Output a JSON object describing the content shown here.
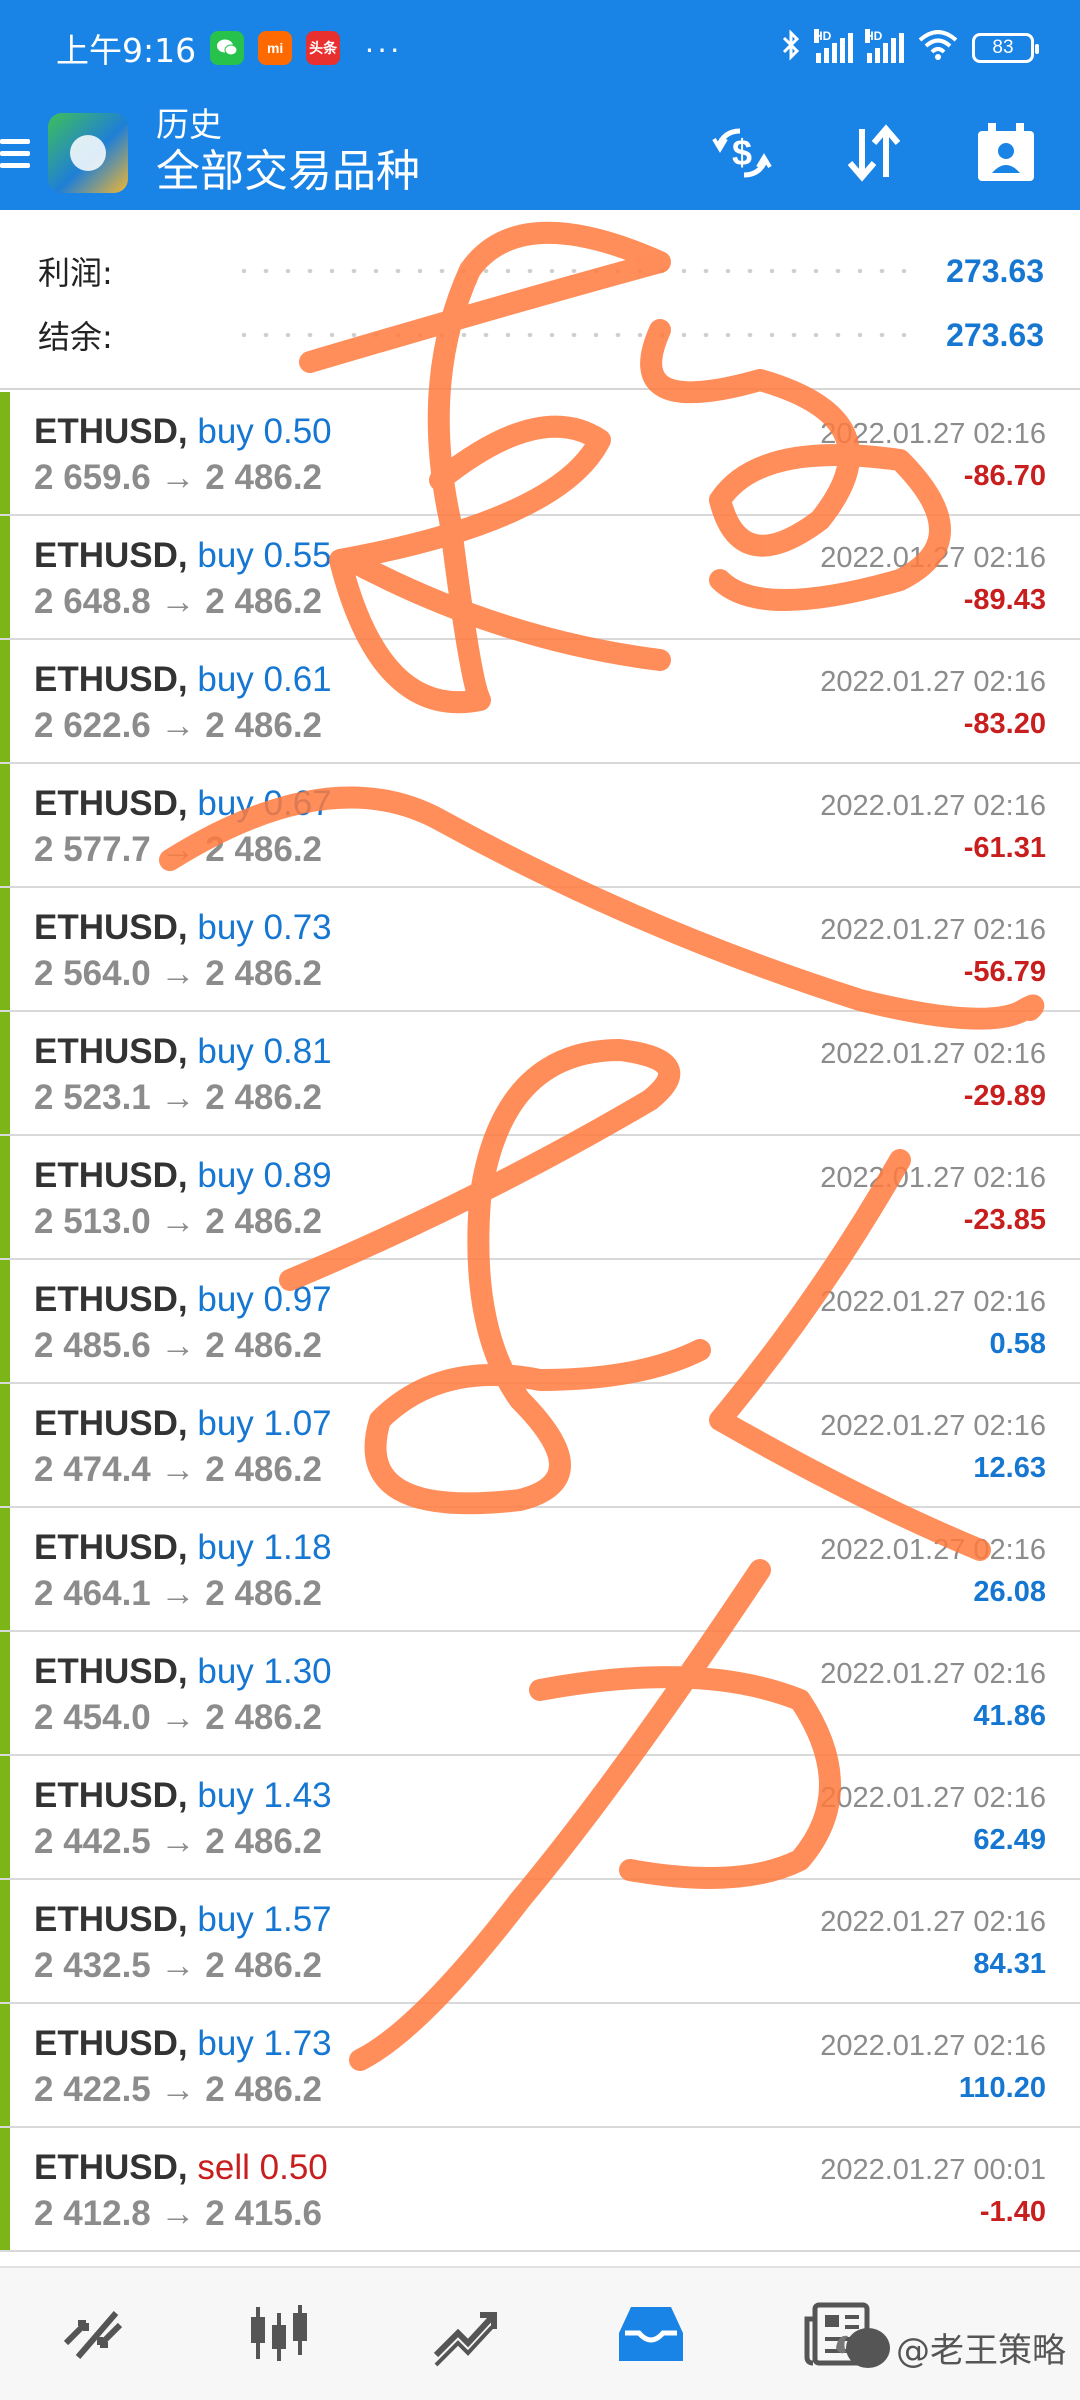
{
  "status_bar": {
    "time": "上午9:16",
    "apps": [
      {
        "label": "",
        "icon": "wechat-icon"
      },
      {
        "label": "mi",
        "icon": "mi-icon"
      },
      {
        "label": "头条",
        "icon": "toutiao-icon"
      }
    ],
    "more": "···",
    "battery": "83",
    "icons": [
      "bluetooth-icon",
      "signal-hd-icon",
      "signal-hd-icon",
      "wifi-icon",
      "battery-icon"
    ]
  },
  "toolbar": {
    "subtitle": "历史",
    "title": "全部交易品种",
    "actions": [
      "currency-exchange-icon",
      "sort-icon",
      "calendar-icon"
    ]
  },
  "summary": {
    "profit_label": "利润:",
    "profit_value": "273.63",
    "balance_label": "结余:",
    "balance_value": "273.63"
  },
  "trades": [
    {
      "symbol": "ETHUSD,",
      "side": "buy",
      "volume": "0.50",
      "from": "2 659.6",
      "to": "2 486.2",
      "date": "2022.01.27 02:16",
      "profit": "-86.70"
    },
    {
      "symbol": "ETHUSD,",
      "side": "buy",
      "volume": "0.55",
      "from": "2 648.8",
      "to": "2 486.2",
      "date": "2022.01.27 02:16",
      "profit": "-89.43"
    },
    {
      "symbol": "ETHUSD,",
      "side": "buy",
      "volume": "0.61",
      "from": "2 622.6",
      "to": "2 486.2",
      "date": "2022.01.27 02:16",
      "profit": "-83.20"
    },
    {
      "symbol": "ETHUSD,",
      "side": "buy",
      "volume": "0.67",
      "from": "2 577.7",
      "to": "2 486.2",
      "date": "2022.01.27 02:16",
      "profit": "-61.31"
    },
    {
      "symbol": "ETHUSD,",
      "side": "buy",
      "volume": "0.73",
      "from": "2 564.0",
      "to": "2 486.2",
      "date": "2022.01.27 02:16",
      "profit": "-56.79"
    },
    {
      "symbol": "ETHUSD,",
      "side": "buy",
      "volume": "0.81",
      "from": "2 523.1",
      "to": "2 486.2",
      "date": "2022.01.27 02:16",
      "profit": "-29.89"
    },
    {
      "symbol": "ETHUSD,",
      "side": "buy",
      "volume": "0.89",
      "from": "2 513.0",
      "to": "2 486.2",
      "date": "2022.01.27 02:16",
      "profit": "-23.85"
    },
    {
      "symbol": "ETHUSD,",
      "side": "buy",
      "volume": "0.97",
      "from": "2 485.6",
      "to": "2 486.2",
      "date": "2022.01.27 02:16",
      "profit": "0.58"
    },
    {
      "symbol": "ETHUSD,",
      "side": "buy",
      "volume": "1.07",
      "from": "2 474.4",
      "to": "2 486.2",
      "date": "2022.01.27 02:16",
      "profit": "12.63"
    },
    {
      "symbol": "ETHUSD,",
      "side": "buy",
      "volume": "1.18",
      "from": "2 464.1",
      "to": "2 486.2",
      "date": "2022.01.27 02:16",
      "profit": "26.08"
    },
    {
      "symbol": "ETHUSD,",
      "side": "buy",
      "volume": "1.30",
      "from": "2 454.0",
      "to": "2 486.2",
      "date": "2022.01.27 02:16",
      "profit": "41.86"
    },
    {
      "symbol": "ETHUSD,",
      "side": "buy",
      "volume": "1.43",
      "from": "2 442.5",
      "to": "2 486.2",
      "date": "2022.01.27 02:16",
      "profit": "62.49"
    },
    {
      "symbol": "ETHUSD,",
      "side": "buy",
      "volume": "1.57",
      "from": "2 432.5",
      "to": "2 486.2",
      "date": "2022.01.27 02:16",
      "profit": "84.31"
    },
    {
      "symbol": "ETHUSD,",
      "side": "buy",
      "volume": "1.73",
      "from": "2 422.5",
      "to": "2 486.2",
      "date": "2022.01.27 02:16",
      "profit": "110.20"
    },
    {
      "symbol": "ETHUSD,",
      "side": "sell",
      "volume": "0.50",
      "from": "2 412.8",
      "to": "2 415.6",
      "date": "2022.01.27 00:01",
      "profit": "-1.40"
    }
  ],
  "arrow": "→",
  "bottom_nav": {
    "items": [
      "quotes-icon",
      "chart-icon",
      "trade-icon",
      "history-icon",
      "news-icon"
    ],
    "active": "history-icon"
  },
  "watermark": "@老王策略",
  "colors": {
    "header": "#1a83e6",
    "positive": "#1577d1",
    "negative": "#c81e1e",
    "row_bar": "#7cb518",
    "scribble": "#ff7a3d"
  }
}
